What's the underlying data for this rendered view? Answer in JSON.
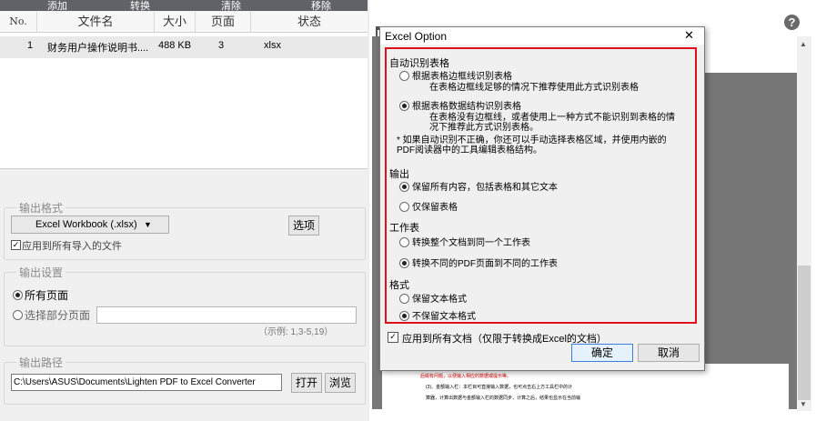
{
  "toolbar": {
    "add": "添加",
    "convert": "转换",
    "clear": "清除",
    "remove": "移除"
  },
  "table": {
    "headers": [
      "No.",
      "文件名",
      "大小",
      "页面",
      "状态"
    ],
    "rows": [
      {
        "no": "1",
        "name": "财务用户操作说明书....",
        "size": "488 KB",
        "pages": "3",
        "status": "xlsx"
      }
    ]
  },
  "output_format": {
    "group_label": "输出格式",
    "format_value": "Excel Workbook (.xlsx)",
    "options_button": "选项",
    "apply_all_label": "应用到所有导入的文件"
  },
  "output_settings": {
    "group_label": "输出设置",
    "all_pages": "所有页面",
    "select_pages": "选择部分页面",
    "example": "（示例:  1,3-5,19）"
  },
  "output_path": {
    "group_label": "输出路径",
    "path": "C:\\Users\\ASUS\\Documents\\Lighten PDF to Excel Converter",
    "open_button": "打开",
    "browse_button": "浏览"
  },
  "viewer": {
    "help": "?"
  },
  "dialog": {
    "title": "Excel Option",
    "close": "✕",
    "auto_detect_label": "自动识别表格",
    "opt_border": "根据表格边框线识别表格",
    "opt_border_desc": "在表格边框线足够的情况下推荐使用此方式识别表格",
    "opt_structure": "根据表格数据结构识别表格",
    "opt_structure_desc1": "在表格没有边框线，或者使用上一种方式不能识别到表格的情",
    "opt_structure_desc2": "况下推荐此方式识别表格。",
    "note1": "* 如果自动识别不正确，你还可以手动选择表格区域，并使用内嵌的",
    "note2": "PDF阅读器中的工具编辑表格结构。",
    "output_label": "输出",
    "keep_all": "保留所有内容，包括表格和其它文本",
    "keep_tables": "仅保留表格",
    "worksheet_label": "工作表",
    "ws_single": "转换整个文档到同一个工作表",
    "ws_multi": "转换不同的PDF页面到不同的工作表",
    "format_label": "格式",
    "keep_format": "保留文本格式",
    "no_format": "不保留文本格式",
    "apply_all": "应用到所有文档（仅限于转换成Excel的文档）",
    "ok": "确定",
    "cancel": "取消"
  },
  "page_text": {
    "line1": "后缀有问题，以便输入相应的数据或提示等。",
    "line2": "(3)、金额输入栏：本栏目可直接输入数据，也可点击右上方工具栏中的计",
    "line3": "算器，计算出数据与金额输入栏的数据同步，计算之后，结果也显示在当前输"
  }
}
